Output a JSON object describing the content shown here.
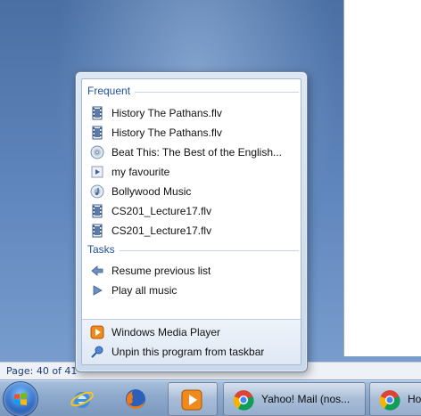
{
  "status_bar": {
    "text": "Page: 40 of 41"
  },
  "jumplist": {
    "frequent": {
      "header": "Frequent",
      "items": [
        {
          "label": "History   The Pathans.flv",
          "icon": "video-file-icon"
        },
        {
          "label": "History   The Pathans.flv",
          "icon": "video-file-icon"
        },
        {
          "label": "Beat This: The Best of the English...",
          "icon": "cd-audio-icon"
        },
        {
          "label": "my favourite",
          "icon": "playlist-icon"
        },
        {
          "label": "Bollywood Music",
          "icon": "music-library-icon"
        },
        {
          "label": "CS201_Lecture17.flv",
          "icon": "video-file-icon"
        },
        {
          "label": "CS201_Lecture17.flv",
          "icon": "video-file-icon"
        }
      ]
    },
    "tasks": {
      "header": "Tasks",
      "items": [
        {
          "label": "Resume previous list",
          "icon": "back-arrow-icon"
        },
        {
          "label": "Play all music",
          "icon": "play-icon"
        }
      ]
    },
    "footer": {
      "items": [
        {
          "label": "Windows Media Player",
          "icon": "media-player-icon"
        },
        {
          "label": "Unpin this program from taskbar",
          "icon": "unpin-icon"
        }
      ]
    }
  },
  "taskbar": {
    "buttons": [
      {
        "name": "internet-explorer",
        "label": ""
      },
      {
        "name": "firefox",
        "label": ""
      },
      {
        "name": "windows-media-player",
        "label": ""
      },
      {
        "name": "chrome-yahoo-mail",
        "label": "Yahoo! Mail (nos..."
      },
      {
        "name": "chrome-second",
        "label": "How"
      }
    ]
  },
  "colors": {
    "section_header": "#1e4fa0",
    "taskbar": "#8eaacd",
    "desktop": "#5f86bd"
  }
}
